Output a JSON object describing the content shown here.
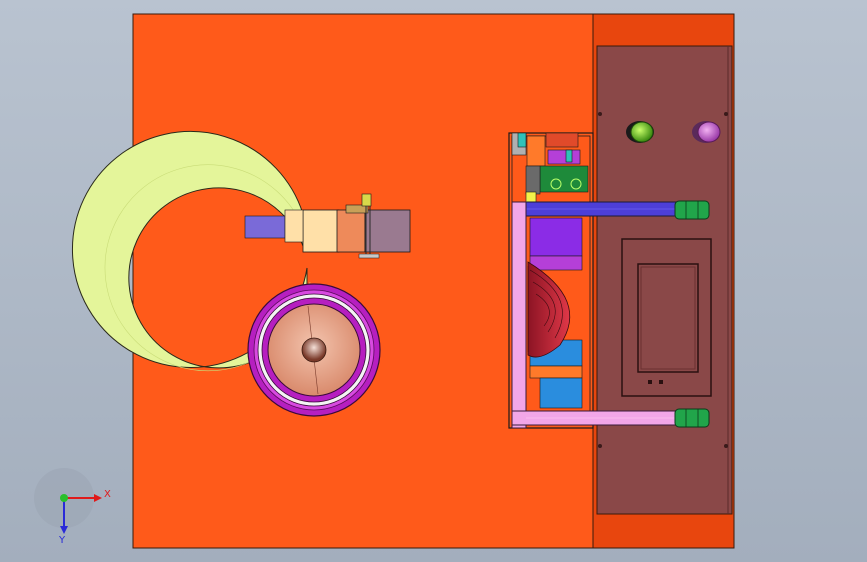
{
  "viewport": {
    "colors": {
      "background_top": "#b9c3d0",
      "background_bottom": "#a3aebd",
      "base_plate": "#ff5a1a",
      "side_panel": "#e8460e",
      "control_panel": "#8a4848",
      "hmi_screen": "#8a4848",
      "spiral_track": "#e4f59a",
      "vibratory_bowl_rim": "#b61fc0",
      "bowl_center": "#e9a286",
      "guide_rail_top": "#4d3fd8",
      "guide_rail_bottom": "#f2a6e8",
      "rail_end_caps": "#21a54a",
      "conveyor_blue": "#2a8dde",
      "conveyor_purple": "#8b2ce6",
      "feeder_red": "#c8283a"
    },
    "icons": {
      "green_button": "green-push-button-icon",
      "purple_button": "purple-push-button-icon"
    }
  },
  "triad": {
    "x_label": "X",
    "y_label": "Y"
  }
}
